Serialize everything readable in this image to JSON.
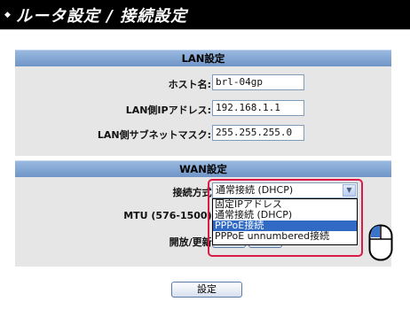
{
  "header": {
    "title": "ルータ設定 / 接続設定",
    "bullet": "◆"
  },
  "lan": {
    "heading": "LAN設定",
    "host_label": "ホスト名:",
    "host_value": "brl-04gp",
    "ip_label": "LAN側IPアドレス:",
    "ip_value": "192.168.1.1",
    "mask_label": "LAN側サブネットマスク:",
    "mask_value": "255.255.255.0"
  },
  "wan": {
    "heading": "WAN設定",
    "method_label": "接続方式:",
    "method_value": "通常接続 (DHCP)",
    "mtu_label": "MTU (576-1500):",
    "release_label": "開放/更新:",
    "options": [
      {
        "label": "固定IPアドレス",
        "selected": false
      },
      {
        "label": "通常接続 (DHCP)",
        "selected": false
      },
      {
        "label": "PPPoE接続",
        "selected": true
      },
      {
        "label": "PPPoE unnumbered接続",
        "selected": false
      }
    ]
  },
  "submit_label": "設定",
  "icons": {
    "mouse": "mouse-icon",
    "dropdown_arrow": "chevron-down-icon"
  }
}
